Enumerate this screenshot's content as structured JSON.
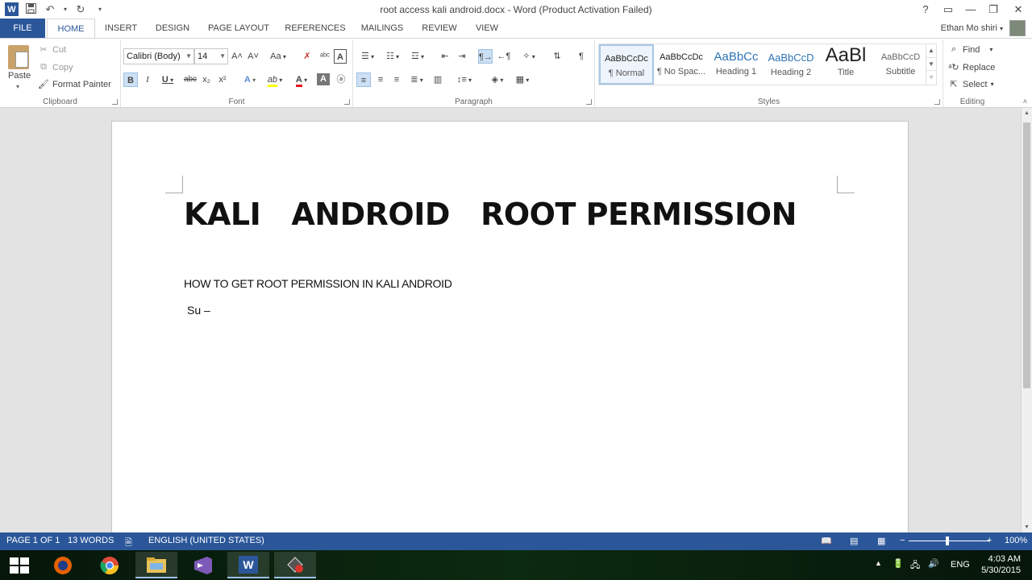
{
  "window": {
    "title": "root access kali android.docx - Word (Product Activation Failed)",
    "minimize": "—",
    "restore": "❐",
    "close": "✕",
    "help": "?",
    "ribbon_display": "▭"
  },
  "qat": {
    "app_icon": "W",
    "save_icon": "💾",
    "undo_icon": "↶",
    "redo_icon": "↻",
    "customize": "▾"
  },
  "tabs": [
    "FILE",
    "HOME",
    "INSERT",
    "DESIGN",
    "PAGE LAYOUT",
    "REFERENCES",
    "MAILINGS",
    "REVIEW",
    "VIEW"
  ],
  "user": {
    "name": "Ethan Mo shiri",
    "dropdown": "▾"
  },
  "clipboard": {
    "group_label": "Clipboard",
    "paste": "Paste",
    "cut": "Cut",
    "copy": "Copy",
    "format_painter": "Format Painter"
  },
  "font": {
    "group_label": "Font",
    "font_name": "Calibri (Body)",
    "font_size": "14",
    "grow": "A˄",
    "shrink": "A˅",
    "change_case": "Aa",
    "clear_format": "✗",
    "bold": "B",
    "italic": "I",
    "underline": "U",
    "strike": "abc",
    "subscript": "x₂",
    "superscript": "x²",
    "text_effects": "A",
    "highlight": "ab",
    "font_color": "A",
    "highlight_color": "#ffff00",
    "font_color_value": "#e81123"
  },
  "paragraph": {
    "group_label": "Paragraph",
    "show_marks": "¶"
  },
  "styles": {
    "group_label": "Styles",
    "items": [
      {
        "sample": "AaBbCcDc",
        "name": "¶ Normal"
      },
      {
        "sample": "AaBbCcDc",
        "name": "¶ No Spac..."
      },
      {
        "sample": "AaBbCc",
        "name": "Heading 1"
      },
      {
        "sample": "AaBbCcD",
        "name": "Heading 2"
      },
      {
        "sample": "AaBl",
        "name": "Title"
      },
      {
        "sample": "AaBbCcD",
        "name": "Subtitle"
      }
    ]
  },
  "editing": {
    "group_label": "Editing",
    "find": "Find",
    "replace": "Replace",
    "select": "Select"
  },
  "document": {
    "title": "KALI   ANDROID   ROOT PERMISSION",
    "p1": "HOW TO GET ROOT PERMISSION IN KALI ANDROID",
    "p2": "Su –"
  },
  "status": {
    "page": "PAGE 1 OF 1",
    "words": "13 WORDS",
    "language": "ENGLISH (UNITED STATES)",
    "zoom": "100%",
    "zoom_minus": "−",
    "zoom_plus": "+"
  },
  "taskbar": {
    "lang": "ENG",
    "time": "4:03 AM",
    "date": "5/30/2015"
  },
  "colors": {
    "accent": "#2b579a",
    "taskbar": "#0c2a10"
  }
}
